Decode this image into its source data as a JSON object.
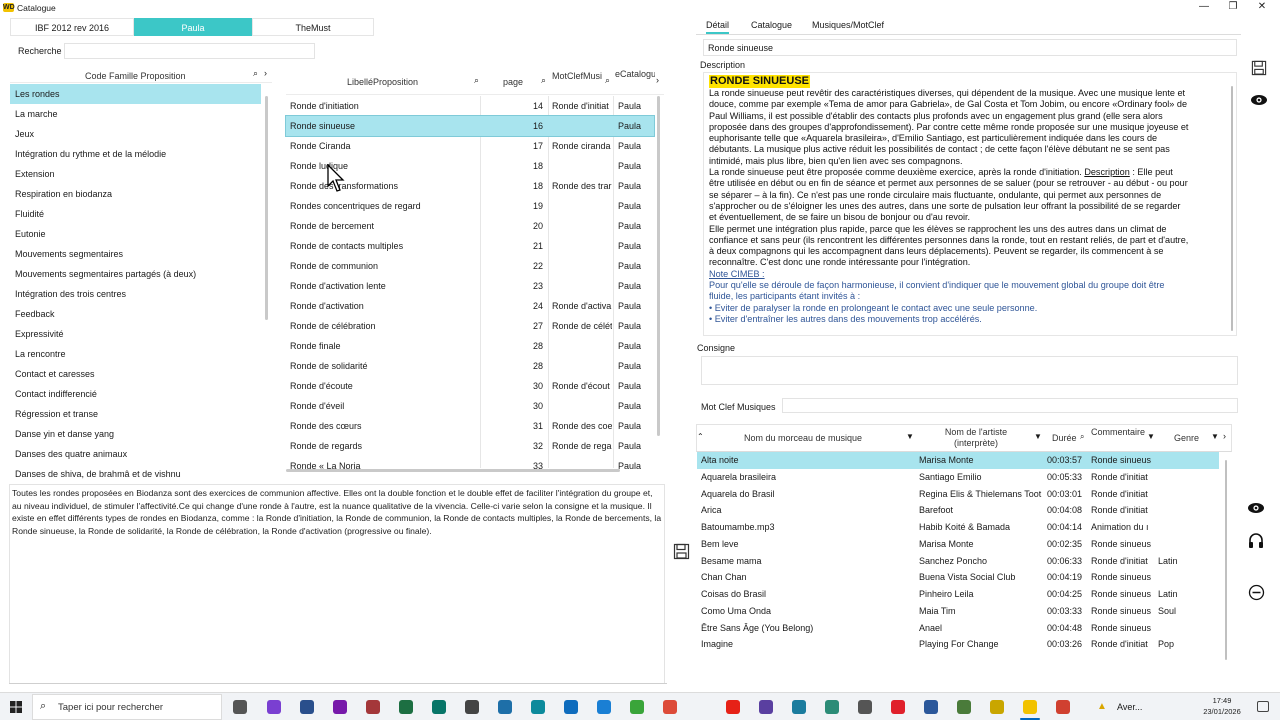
{
  "window": {
    "title": "Catalogue",
    "icon_text": "WD",
    "minimize": "—",
    "maximize": "❐",
    "close": "✕"
  },
  "top_tabs": [
    "IBF 2012 rev 2016",
    "Paula",
    "TheMust"
  ],
  "search": {
    "label": "Recherche",
    "value": ""
  },
  "families": {
    "header": "Code Famille Proposition",
    "items": [
      "Les rondes",
      "La marche",
      "Jeux",
      "Intégration du rythme et de la mélodie",
      "Extension",
      "Respiration en biodanza",
      "Fluidité",
      "Eutonie",
      "Mouvements segmentaires",
      "Mouvements segmentaires partagés (à deux)",
      "Intégration des trois centres",
      "Feedback",
      "Expressivité",
      "La rencontre",
      "Contact et caresses",
      "Contact indifferencié",
      "Régression et transe",
      "Danse yin et danse yang",
      "Danses des quatre animaux",
      "Danses de shiva, de brahmâ et de vishnu"
    ]
  },
  "propositions": {
    "headers": [
      "LibelléProposition",
      "page",
      "MotClefMusi",
      "eCatalogu"
    ],
    "rows": [
      [
        "Ronde d'initiation",
        "14",
        "Ronde d'initiat",
        "Paula"
      ],
      [
        "Ronde sinueuse",
        "16",
        "",
        "Paula"
      ],
      [
        "Ronde Ciranda",
        "17",
        "Ronde ciranda",
        "Paula"
      ],
      [
        "Ronde ludique",
        "18",
        "",
        "Paula"
      ],
      [
        "Ronde des transformations",
        "18",
        "Ronde des trar",
        "Paula"
      ],
      [
        "Rondes concentriques de regard",
        "19",
        "",
        "Paula"
      ],
      [
        "Ronde de bercement",
        "20",
        "",
        "Paula"
      ],
      [
        "Ronde de contacts multiples",
        "21",
        "",
        "Paula"
      ],
      [
        "Ronde de communion",
        "22",
        "",
        "Paula"
      ],
      [
        "Ronde d'activation lente",
        "23",
        "",
        "Paula"
      ],
      [
        "Ronde d'activation",
        "24",
        "Ronde d'activa",
        "Paula"
      ],
      [
        "Ronde de célébration",
        "27",
        "Ronde de célét",
        "Paula"
      ],
      [
        "Ronde finale",
        "28",
        "",
        "Paula"
      ],
      [
        "Ronde de solidarité",
        "28",
        "",
        "Paula"
      ],
      [
        "Ronde d'écoute",
        "30",
        "Ronde d'écout",
        "Paula"
      ],
      [
        "Ronde d'éveil",
        "30",
        "",
        "Paula"
      ],
      [
        "Ronde des cœurs",
        "31",
        "Ronde des coe",
        "Paula"
      ],
      [
        "Ronde de regards",
        "32",
        "Ronde de rega",
        "Paula"
      ],
      [
        "Ronde « La Noria",
        "33",
        "",
        "Paula"
      ]
    ]
  },
  "family_note": "Toutes les rondes proposées en Biodanza sont des exercices de communion affective. Elles ont la double fonction et le double effet de faciliter l'intégration du groupe et, au niveau individuel, de stimuler l'affectivité.Ce qui change d'une ronde à l'autre, est la nuance qualitative de la vivencia. Celle-ci varie selon la consigne et la musique. Il existe en effet différents types de rondes en Biodanza, comme : la Ronde d'initiation, la Ronde de communion, la Ronde de contacts multiples, la Ronde de bercements, la Ronde sinueuse, la Ronde de solidarité, la Ronde de célébration, la Ronde d'activation (progressive ou finale).",
  "right_tabs": [
    "Détail",
    "Catalogue",
    "Musiques/MotClef"
  ],
  "detail": {
    "name": "Ronde sinueuse",
    "description_label": "Description",
    "desc_heading": "RONDE SINUEUSE",
    "desc_p1": "La ronde sinueuse peut revêtir des caractéristiques diverses, qui dépendent de la musique. Avec une musique lente et douce, comme par exemple «Tema de amor para Gabriela», de Gal Costa et Tom Jobim, ou encore «Ordinary fool» de Paul Williams, il est possible d'établir des contacts plus profonds avec un engagement plus grand (elle sera alors proposée dans des groupes d'approfondissement). Par contre cette même ronde proposée sur une musique joyeuse et euphorisante telle que «Aquarela brasileira», d'Emilio Santiago, est particulièrement indiquée dans les cours de débutants. La musique plus active réduit les possibilités de contact ; de cette façon l'élève débutant ne se sent pas intimidé, mais plus libre, bien qu'en lien avec ses compagnons.",
    "desc_p2a": "La ronde sinueuse peut être proposée comme deuxième exercice, après la ronde d'initiation. ",
    "desc_p2_link": "Description",
    "desc_p2b": " : Elle peut être utilisée en début ou en fin de séance et permet aux personnes de se saluer (pour se retrouver - au début - ou pour se séparer – à la fin). Ce n'est pas une ronde circulaire mais fluctuante, ondulante, qui permet aux personnes de s'approcher ou de s'éloigner les unes des autres, dans une sorte de pulsation leur offrant la possibilité de se regarder et éventuellement, de se faire un bisou de bonjour ou d'au revoir.",
    "desc_p3": "Elle permet une intégration plus rapide, parce que les élèves se rapprochent les uns des autres dans un climat de confiance et sans peur (ils rencontrent les différentes personnes dans la ronde, tout en restant reliés, de part et d'autre, à deux compagnons qui les accompagnent dans leurs déplacements). Peuvent se regarder, ils commencent à se reconnaître. C'est donc une ronde intéressante pour l'intégration.",
    "note_title": "Note CIMEB :",
    "note_text": "Pour qu'elle se déroule de façon harmonieuse, il convient d'indiquer que le mouvement global du groupe doit être fluide, les participants étant invités à :",
    "bullet1": "Eviter de paralyser la ronde en prolongeant le contact avec une seule personne.",
    "bullet2": "Eviter d'entraîner les autres dans des mouvements trop accélérés.",
    "consigne_label": "Consigne",
    "consigne_value": "",
    "motclef_label": "Mot Clef Musiques",
    "motclef_value": ""
  },
  "music": {
    "headers": [
      "Nom du morceau de musique",
      "Nom de l'artiste (interprète)",
      "Durée",
      "Commentaire",
      "Genre"
    ],
    "rows": [
      [
        "Alta noite",
        "Marisa Monte",
        "00:03:57",
        "Ronde sinueus",
        ""
      ],
      [
        "Aquarela brasileira",
        "Santiago Emilio",
        "00:05:33",
        "Ronde d'initiat",
        ""
      ],
      [
        "Aquarela do Brasil",
        "Regina Elis & Thielemans Toot",
        "00:03:01",
        "Ronde d'initiat",
        ""
      ],
      [
        "Arica",
        "Barefoot",
        "00:04:08",
        "Ronde d'initiat",
        ""
      ],
      [
        "Batoumambe.mp3",
        "Habib Koité & Bamada",
        "00:04:14",
        "Animation du ı",
        ""
      ],
      [
        "Bem leve",
        "Marisa Monte",
        "00:02:35",
        "Ronde sinueus",
        ""
      ],
      [
        "Besame mama",
        "Sanchez Poncho",
        "00:06:33",
        "Ronde d'initiat",
        "Latin"
      ],
      [
        "Chan Chan",
        "Buena Vista Social Club",
        "00:04:19",
        "Ronde sinueus",
        ""
      ],
      [
        "Coisas do Brasil",
        "Pinheiro Leila",
        "00:04:25",
        "Ronde sinueus",
        "Latin"
      ],
      [
        "Como Uma Onda",
        "Maia Tim",
        "00:03:33",
        "Ronde sinueus",
        "Soul"
      ],
      [
        "Être Sans Âge (You Belong)",
        "Anael",
        "00:04:48",
        "Ronde sinueus",
        ""
      ],
      [
        "Imagine",
        "Playing For Change",
        "00:03:26",
        "Ronde d'initiat",
        "Pop"
      ]
    ]
  },
  "taskbar": {
    "search_placeholder": "Taper ici pour rechercher",
    "weather": "Aver...",
    "time": "17:49",
    "date": "23/01/2026"
  },
  "colors": {
    "accent": "#3cc7c7",
    "selection": "#a8e4ee",
    "highlight": "#ffe300"
  }
}
